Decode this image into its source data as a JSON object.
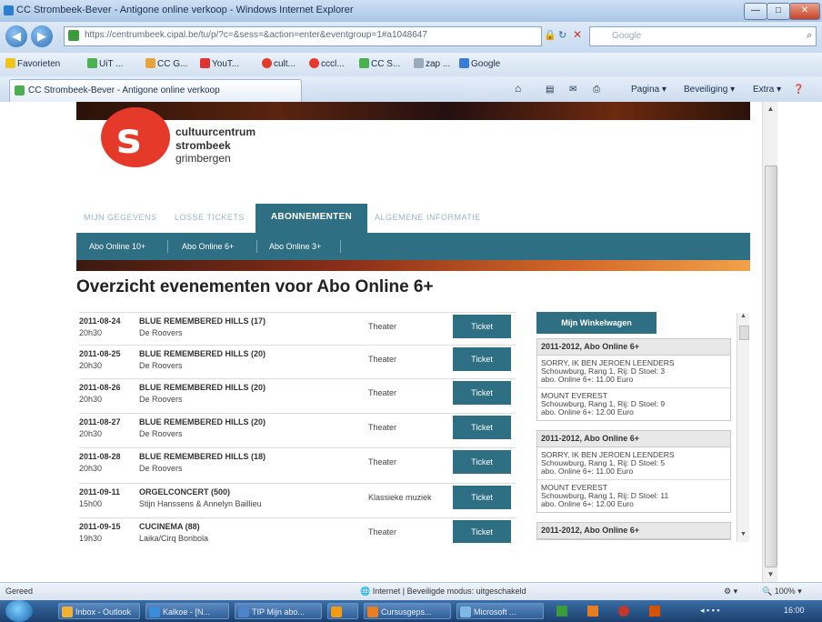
{
  "window": {
    "title": "CC Strombeek-Bever - Antigone online verkoop - Windows Internet Explorer",
    "btn_min": "—",
    "btn_max": "□",
    "btn_close": "✕"
  },
  "address": {
    "url": "https://centrumbeek.cipal.be/tu/p/?c=&sess=&action=enter&eventgroup=1#a1048647",
    "search_placeholder": "Google"
  },
  "favorites": {
    "label": "Favorieten",
    "items": [
      "UiT ...",
      "CC G...",
      "YouT...",
      "cult...",
      "cccl...",
      "CC S...",
      "zap ...",
      "Google"
    ]
  },
  "tabs": {
    "active": "CC Strombeek-Bever - Antigone online verkoop",
    "commands": [
      "Pagina ▾",
      "Beveiliging ▾",
      "Extra ▾"
    ]
  },
  "site": {
    "logo_lines": [
      "cultuurcentrum",
      "strombeek",
      "grimbergen"
    ],
    "nav": [
      "MIJN GEGEVENS",
      "LOSSE TICKETS",
      "ABONNEMENTEN",
      "ALGEMENE INFORMATIE"
    ],
    "subnav": [
      "Abo Online 10+",
      "Abo Online 6+",
      "Abo Online 3+"
    ],
    "heading": "Overzicht evenementen voor Abo Online 6+",
    "ticket_label": "Ticket",
    "events": [
      {
        "date": "2011-08-24",
        "time": "20h30",
        "title": "BLUE REMEMBERED HILLS  (17)",
        "artist": "De Roovers",
        "genre": "Theater"
      },
      {
        "date": "2011-08-25",
        "time": "20h30",
        "title": "BLUE REMEMBERED HILLS  (20)",
        "artist": "De Roovers",
        "genre": "Theater"
      },
      {
        "date": "2011-08-26",
        "time": "20h30",
        "title": "BLUE REMEMBERED HILLS  (20)",
        "artist": "De Roovers",
        "genre": "Theater"
      },
      {
        "date": "2011-08-27",
        "time": "20h30",
        "title": "BLUE REMEMBERED HILLS  (20)",
        "artist": "De Roovers",
        "genre": "Theater"
      },
      {
        "date": "2011-08-28",
        "time": "20h30",
        "title": "BLUE REMEMBERED HILLS  (18)",
        "artist": "De Roovers",
        "genre": "Theater"
      },
      {
        "date": "2011-09-11",
        "time": "15h00",
        "title": "ORGELCONCERT  (500)",
        "artist": "Stijn Hanssens & Annelyn Baillieu",
        "genre": "Klassieke muziek"
      },
      {
        "date": "2011-09-15",
        "time": "19h30",
        "title": "CUCINEMA  (88)",
        "artist": "Laika/Cirq Bonbola",
        "genre": "Theater"
      }
    ],
    "cart_button": "Mijn Winkelwagen",
    "cart_blocks": [
      {
        "header": "2011-2012, Abo Online 6+",
        "items": [
          {
            "title": "SORRY, IK BEN JEROEN LEENDERS",
            "seat": "Schouwburg, Rang 1, Rij: D Stoel: 3",
            "price": "abo. Online 6+: 11.00 Euro"
          },
          {
            "title": "MOUNT EVEREST",
            "seat": "Schouwburg, Rang 1, Rij: D Stoel: 9",
            "price": "abo. Online 6+: 12.00 Euro"
          }
        ]
      },
      {
        "header": "2011-2012, Abo Online 6+",
        "items": [
          {
            "title": "SORRY, IK BEN JEROEN LEENDERS",
            "seat": "Schouwburg, Rang 1, Rij: D Stoel: 5",
            "price": "abo. Online 6+: 11.00 Euro"
          },
          {
            "title": "MOUNT EVEREST",
            "seat": "Schouwburg, Rang 1, Rij: D Stoel: 11",
            "price": "abo. Online 6+: 12.00 Euro"
          }
        ]
      },
      {
        "header": "2011-2012, Abo Online 6+",
        "items": []
      }
    ]
  },
  "status": {
    "left": "Gereed",
    "zone": "Internet | Beveiligde modus: uitgeschakeld",
    "zoom": "100%"
  },
  "taskbar": {
    "items": [
      "Inbox - Outlook",
      "Kalkoe - [N...",
      "TIP Mijn abo...",
      "",
      "Cursusgeps...",
      "Microsoft ..."
    ],
    "clock": "16:00"
  },
  "colors": {
    "site_teal": "#2e6f83",
    "logo_red": "#e53a2a"
  }
}
